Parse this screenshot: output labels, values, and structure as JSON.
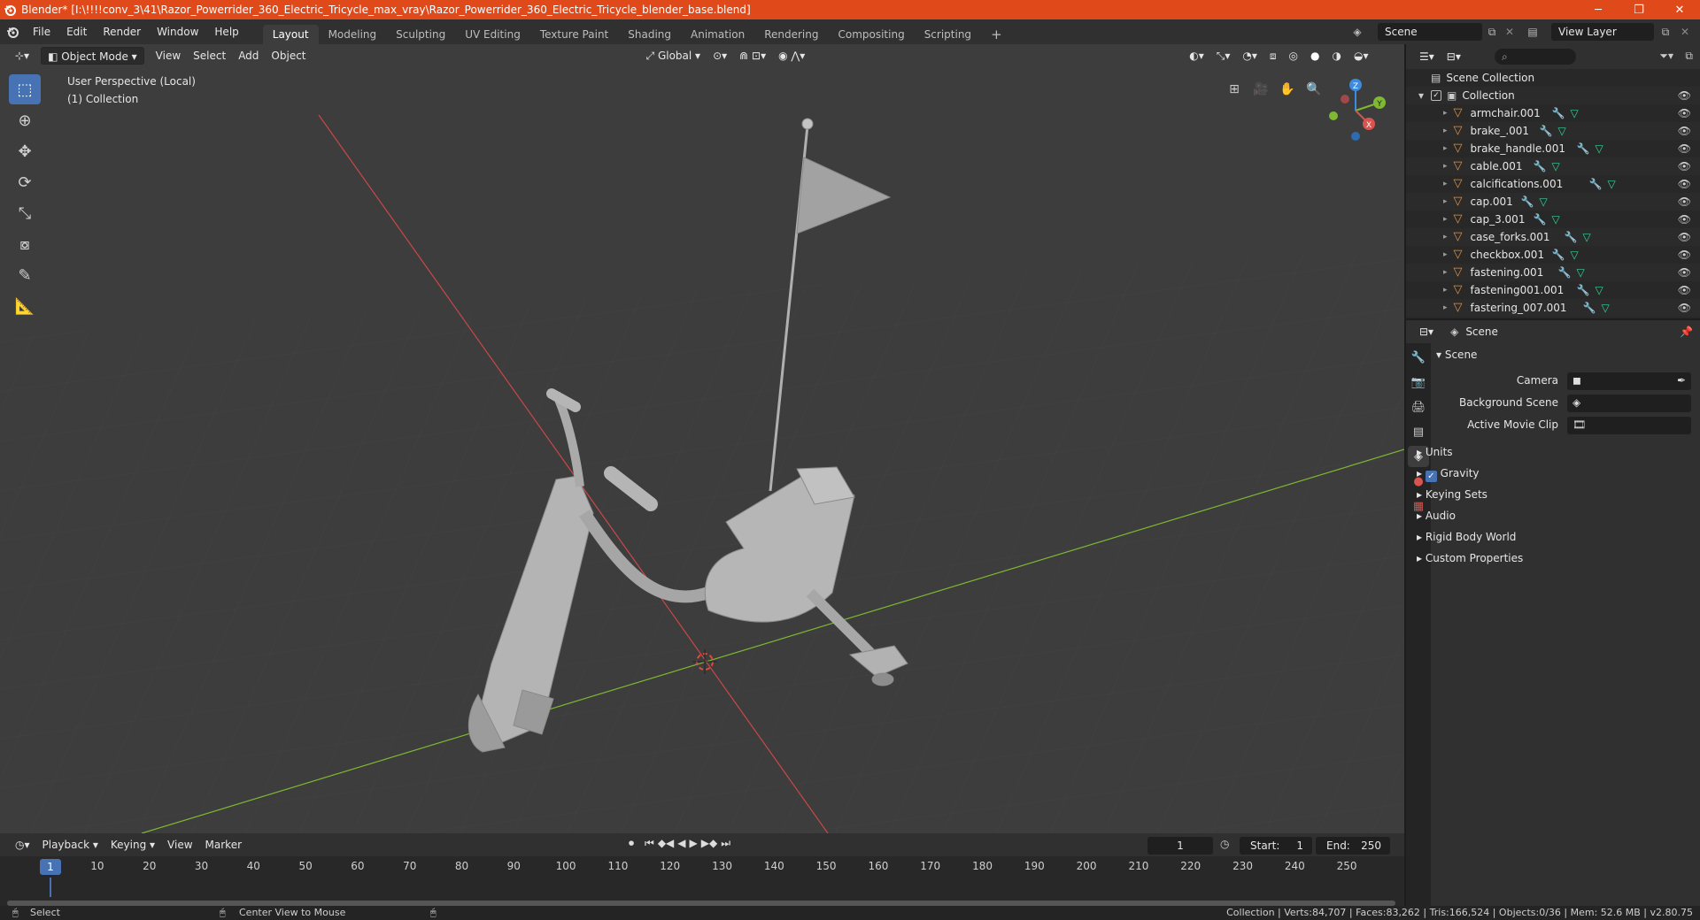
{
  "window": {
    "title": "Blender* [I:\\!!!!conv_3\\41\\Razor_Powerrider_360_Electric_Tricycle_max_vray\\Razor_Powerrider_360_Electric_Tricycle_blender_base.blend]",
    "minimize": "─",
    "maximize": "❐",
    "close": "✕"
  },
  "menu": [
    "File",
    "Edit",
    "Render",
    "Window",
    "Help"
  ],
  "workspaces": [
    "Layout",
    "Modeling",
    "Sculpting",
    "UV Editing",
    "Texture Paint",
    "Shading",
    "Animation",
    "Rendering",
    "Compositing",
    "Scripting"
  ],
  "active_workspace": "Layout",
  "scene_name": "Scene",
  "view_layer": "View Layer",
  "viewport": {
    "mode": "Object Mode",
    "menus": [
      "View",
      "Select",
      "Add",
      "Object"
    ],
    "transform_orientation": "Global",
    "info_line1": "User Perspective (Local)",
    "info_line2": "(1) Collection",
    "gizmo_x": "X",
    "gizmo_y": "Y",
    "gizmo_z": "Z"
  },
  "timeline": {
    "menus": [
      "Playback",
      "Keying",
      "View",
      "Marker"
    ],
    "current_frame": "1",
    "start_label": "Start:",
    "start": "1",
    "end_label": "End:",
    "end": "250",
    "ticks": [
      "1",
      "10",
      "20",
      "30",
      "40",
      "50",
      "60",
      "70",
      "80",
      "90",
      "100",
      "110",
      "120",
      "130",
      "140",
      "150",
      "160",
      "170",
      "180",
      "190",
      "200",
      "210",
      "220",
      "230",
      "240",
      "250"
    ]
  },
  "outliner": {
    "root": "Scene Collection",
    "collection": "Collection",
    "items": [
      "armchair.001",
      "brake_.001",
      "brake_handle.001",
      "cable.001",
      "calcifications.001",
      "cap.001",
      "cap_3.001",
      "case_forks.001",
      "checkbox.001",
      "fastening.001",
      "fastening001.001",
      "fastering_007.001"
    ]
  },
  "properties": {
    "context": "Scene",
    "panel": "Scene",
    "camera_label": "Camera",
    "background_scene_label": "Background Scene",
    "active_movie_clip_label": "Active Movie Clip",
    "subpanels": [
      "Units",
      "Gravity",
      "Keying Sets",
      "Audio",
      "Rigid Body World",
      "Custom Properties"
    ]
  },
  "status": {
    "select": "Select",
    "center_view": "Center View to Mouse",
    "stats": "Collection | Verts:84,707 | Faces:83,262 | Tris:166,524 | Objects:0/36 | Mem: 52.6 MB | v2.80.75"
  },
  "colors": {
    "titlebar": "#e04a1a",
    "accent": "#4772b3",
    "x_axis": "#d9534f",
    "y_axis": "#7fb832",
    "z_axis": "#3d8be0"
  }
}
